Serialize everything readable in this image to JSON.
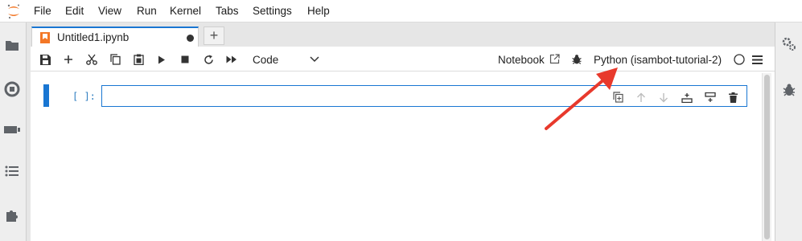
{
  "menubar": {
    "items": [
      "File",
      "Edit",
      "View",
      "Run",
      "Kernel",
      "Tabs",
      "Settings",
      "Help"
    ]
  },
  "tab": {
    "title": "Untitled1.ipynb",
    "add_label": "+"
  },
  "toolbar": {
    "cell_type": "Code",
    "notebook_label": "Notebook",
    "kernel_name": "Python (isambot-tutorial-2)"
  },
  "cell": {
    "prompt": "[ ]:"
  },
  "colors": {
    "accent": "#1976d2",
    "annotation_arrow": "#e8392c",
    "jupyter_orange": "#f37726"
  },
  "icons": {
    "left_sidebar": [
      "folder-icon",
      "running-icon",
      "tabs-icon",
      "toc-icon",
      "extension-icon"
    ],
    "right_sidebar": [
      "property-inspector-icon",
      "debugger-icon"
    ]
  }
}
